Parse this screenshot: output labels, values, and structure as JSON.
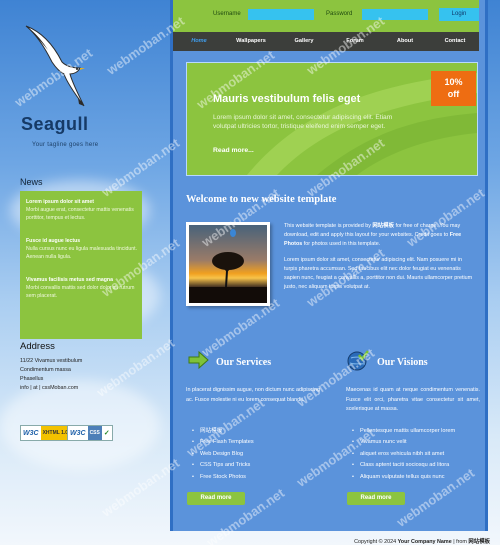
{
  "site": {
    "title": "Seagull",
    "tagline": "Your tagline goes here"
  },
  "header": {
    "username_label": "Username",
    "password_label": "Password",
    "login_button": "Login"
  },
  "nav": [
    "Home",
    "Wallpapers",
    "Gallery",
    "Forum",
    "About",
    "Contact"
  ],
  "banner": {
    "title": "Mauris vestibulum felis eget",
    "text": "Lorem ipsum dolor sit amet, consectetur adipiscing elit. Etiam volutpat ultricies tortor, tristique eleifend enim semper eget.",
    "read_more": "Read more...",
    "offer_value": "10%",
    "offer_label": "off"
  },
  "news": {
    "heading": "News",
    "items": [
      {
        "title": "Lorem ipsum dolor sit amet",
        "body": "Morbi augue erat, consectetur mattis venenatis porttitor, tempus et lectus."
      },
      {
        "title": "Fusce id augue lectus",
        "body": "Nulla cursus nunc eu ligula malesuada tincidunt. Aenean nulla ligula."
      },
      {
        "title": "Vivamus facilisis metus sed magna",
        "body": "Morbi convallis mattis sed dolor dolor sit rutrum sem placerat."
      }
    ]
  },
  "address": {
    "heading": "Address",
    "lines": [
      "11/22 Vivamus vestibulum",
      "Condimentum massa",
      "Phasellus",
      "info | at | cssMoban.com"
    ]
  },
  "badges": {
    "xhtml": "XHTML 1.0",
    "css": "CSS"
  },
  "welcome": {
    "heading": "Welcome to new website template",
    "p1_a": "This website template is provided by ",
    "p1_brand": "网站模板",
    "p1_b": " for free of charge. You may download, edit and apply this layout for your websites. Credit goes to ",
    "p1_link": "Free Photos",
    "p1_c": " for photos used in this template.",
    "p2": "Lorem ipsum dolor sit amet, consectetur adipiscing elit. Nam posuere mi in turpis pharetra accumsan. Sed faucibus elit nec dolor feugiat eu venenatis sapien nunc, feugiat a convallis a, porttitor non dui. Mauris ullamcorper pretium justo, nec aliquam turpis volutpat at."
  },
  "services": {
    "heading": "Our Services",
    "text": "In placerat dignissim augue, non dictum nunc adipiscing ac. Fusce molestie ni eu lorem consequat blandit.",
    "list": [
      "网站模板",
      "Free Flash Templates",
      "Web Design Blog",
      "CSS Tips and Tricks",
      "Free Stock Photos"
    ],
    "button": "Read more"
  },
  "visions": {
    "heading": "Our Visions",
    "text": "Maecenas id quam at neque condimentum venenatis. Fusce elit orci, pharetra vitae consectetur sit amet, scelerisque at massa.",
    "list": [
      "Pellentesque mattis ullamcorper lorem",
      "Vivamus nunc velit",
      "aliquet eros vehicula nibh sit amet",
      "Class aptent taciti sociosqu ad litora",
      "Aliquam vulputate tellus quis nunc"
    ],
    "button": "Read more"
  },
  "footer": {
    "prefix": "Copyright © 2024 ",
    "company": "Your Company Name",
    "sep": " | from ",
    "brand": "网站模板"
  },
  "watermark": "webmoban.net",
  "colors": {
    "accent_green": "#8cc43f",
    "main_blue": "#5b93db",
    "nav_dark": "#3c3e3b",
    "input_cyan": "#36c2ef",
    "offer_orange": "#ee6d12"
  }
}
